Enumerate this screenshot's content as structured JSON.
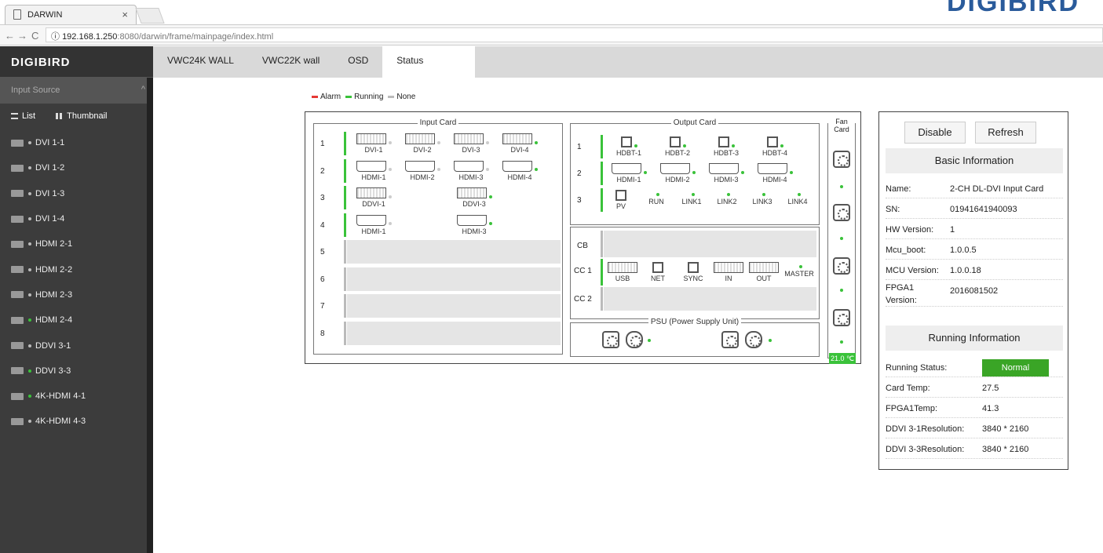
{
  "browser": {
    "tab_title": "DARWIN",
    "url_host": "192.168.1.250",
    "url_path": ":8080/darwin/frame/mainpage/index.html",
    "brand_watermark": "DIGIBIRD"
  },
  "sidebar": {
    "logo": "DIGIBIRD",
    "section": "Input Source",
    "view_list": "List",
    "view_thumb": "Thumbnail",
    "items": [
      {
        "label": "DVI 1-1",
        "active": false
      },
      {
        "label": "DVI 1-2",
        "active": false
      },
      {
        "label": "DVI 1-3",
        "active": false
      },
      {
        "label": "DVI 1-4",
        "active": false
      },
      {
        "label": "HDMI 2-1",
        "active": false
      },
      {
        "label": "HDMI 2-2",
        "active": false
      },
      {
        "label": "HDMI 2-3",
        "active": false
      },
      {
        "label": "HDMI 2-4",
        "active": true
      },
      {
        "label": "DDVI 3-1",
        "active": false
      },
      {
        "label": "DDVI 3-3",
        "active": true
      },
      {
        "label": "4K-HDMI 4-1",
        "active": true
      },
      {
        "label": "4K-HDMI 4-3",
        "active": false
      }
    ]
  },
  "topnav": {
    "tabs": [
      "VWC24K WALL",
      "VWC22K wall",
      "OSD",
      "Status"
    ],
    "active": "Status"
  },
  "legend": {
    "alarm": "Alarm",
    "running": "Running",
    "none": "None",
    "colors": {
      "alarm": "#e53935",
      "running": "#3ac23a",
      "none": "#bbbbbb"
    }
  },
  "chassis": {
    "input_title": "Input Card",
    "output_title": "Output Card",
    "fan_title": "Fan Card",
    "psu_title": "PSU (Power Supply Unit)",
    "input_rows": [
      {
        "num": "1",
        "ports": [
          "DVI-1",
          "DVI-2",
          "DVI-3",
          "DVI-4"
        ]
      },
      {
        "num": "2",
        "ports": [
          "HDMI-1",
          "HDMI-2",
          "HDMI-3",
          "HDMI-4"
        ]
      },
      {
        "num": "3",
        "ports": [
          "DDVI-1",
          "DDVI-3"
        ]
      },
      {
        "num": "4",
        "ports": [
          "HDMI-1",
          "HDMI-3"
        ]
      },
      {
        "num": "5"
      },
      {
        "num": "6"
      },
      {
        "num": "7"
      },
      {
        "num": "8"
      }
    ],
    "output_rows": [
      {
        "num": "1",
        "ports": [
          "HDBT-1",
          "HDBT-2",
          "HDBT-3",
          "HDBT-4"
        ]
      },
      {
        "num": "2",
        "ports": [
          "HDMI-1",
          "HDMI-2",
          "HDMI-3",
          "HDMI-4"
        ]
      },
      {
        "num": "3",
        "ports": [
          "PV",
          "RUN",
          "LINK1",
          "LINK2",
          "LINK3",
          "LINK4"
        ]
      }
    ],
    "cb": "CB",
    "cc1": "CC 1",
    "cc2": "CC 2",
    "cc1_ports": [
      "USB",
      "NET",
      "SYNC",
      "IN",
      "OUT",
      "MASTER"
    ],
    "fan_temp": "21.0 ℃"
  },
  "panel": {
    "disable": "Disable",
    "refresh": "Refresh",
    "basic_title": "Basic Information",
    "running_title": "Running Information",
    "basic": [
      {
        "k": "Name:",
        "v": "2-CH DL-DVI Input Card"
      },
      {
        "k": "SN:",
        "v": "01941641940093"
      },
      {
        "k": "HW Version:",
        "v": "1"
      },
      {
        "k": "Mcu_boot:",
        "v": "1.0.0.5"
      },
      {
        "k": "MCU Version:",
        "v": "1.0.0.18"
      },
      {
        "k": "FPGA1 Version:",
        "v": "2016081502"
      }
    ],
    "running": [
      {
        "k": "Running Status:",
        "v": "Normal"
      },
      {
        "k": "Card Temp:",
        "v": "27.5"
      },
      {
        "k": "FPGA1Temp:",
        "v": "41.3"
      },
      {
        "k": "DDVI 3-1Resolution:",
        "v": "3840 * 2160"
      },
      {
        "k": "DDVI 3-3Resolution:",
        "v": "3840 * 2160"
      }
    ]
  }
}
